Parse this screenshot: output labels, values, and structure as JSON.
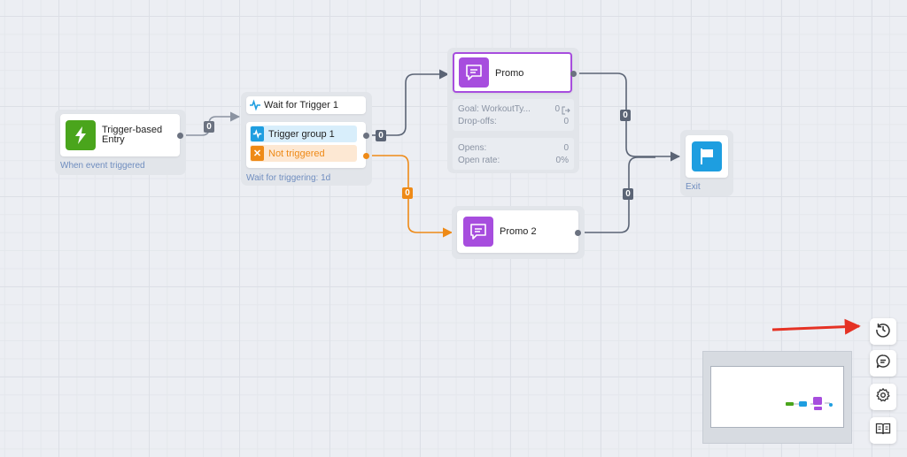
{
  "colors": {
    "green": "#4aa51c",
    "blue": "#1e9ee0",
    "purple": "#a74dde",
    "orange": "#ee8a17",
    "edge": "#5b6475",
    "arrow_red": "#e53224"
  },
  "entry": {
    "title": "Trigger-based Entry",
    "footer": "When event triggered",
    "icon": "lightning-icon"
  },
  "wait": {
    "title": "Wait for Trigger 1",
    "group_label": "Trigger group 1",
    "not_triggered_label": "Not triggered",
    "footer": "Wait for triggering: 1d",
    "icon": "pulse-icon"
  },
  "promo": {
    "title": "Promo",
    "goal_label": "Goal: WorkoutTy...",
    "goal_value": "0",
    "dropoffs_label": "Drop-offs:",
    "dropoffs_value": "0",
    "opens_label": "Opens:",
    "opens_value": "0",
    "openrate_label": "Open rate:",
    "openrate_value": "0%",
    "icon": "message-icon"
  },
  "promo2": {
    "title": "Promo 2",
    "icon": "message-icon"
  },
  "exit": {
    "title": "Exit",
    "icon": "flag-icon"
  },
  "edge_counts": {
    "entry_to_wait": "0",
    "group_to_promo": "0",
    "not_triggered_to_promo2": "0",
    "promo_to_exit": "0",
    "promo2_to_exit": "0"
  },
  "toolbar": {
    "history": "history-icon",
    "comments": "comment-icon",
    "settings": "gear-icon",
    "docs": "book-icon"
  }
}
